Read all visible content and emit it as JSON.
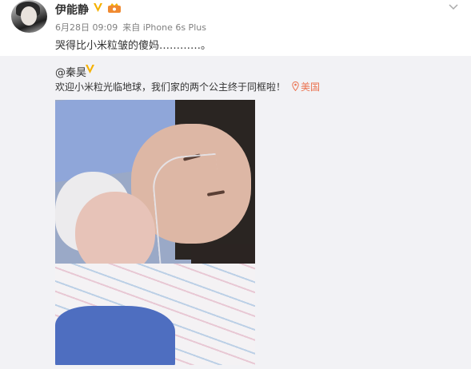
{
  "post": {
    "username": "伊能静",
    "date": "6月28日 09:09",
    "source_prefix": "来自",
    "source": "iPhone 6s Plus",
    "text": "哭得比小米粒皱的傻妈…………。"
  },
  "repost": {
    "author": "@秦昊",
    "text": "欢迎小米粒光临地球，我们家的两个公主终于同框啦！",
    "location": "美国"
  },
  "icons": {
    "verified": "verified-v-icon",
    "vip": "vip-crown-icon",
    "menu": "chevron-down-icon",
    "location": "location-pin-icon"
  },
  "colors": {
    "verified": "#f5b100",
    "location": "#eb7350",
    "repost_bg": "#f2f2f5",
    "meta_text": "#808080"
  }
}
